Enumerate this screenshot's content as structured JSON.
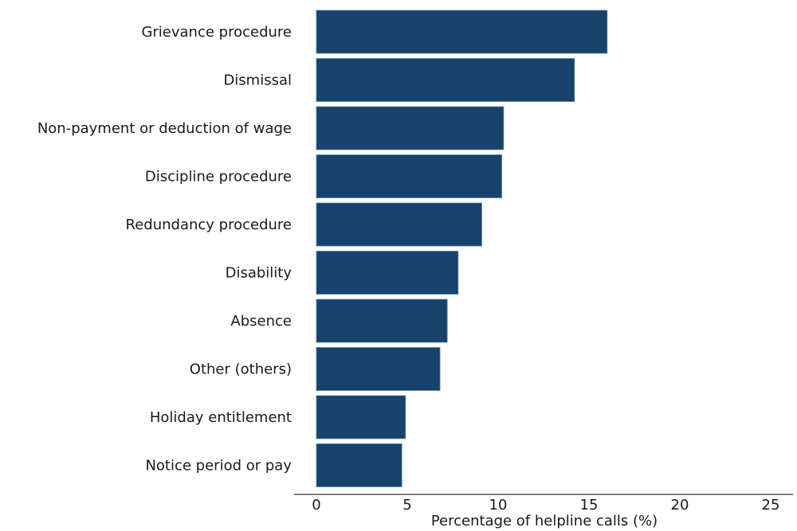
{
  "chart_data": {
    "type": "bar",
    "orientation": "horizontal",
    "title": "",
    "xlabel": "Percentage of helpline calls (%)",
    "ylabel": "",
    "xlim": [
      0,
      25
    ],
    "xticks": [
      0,
      5,
      10,
      15,
      20,
      25
    ],
    "xtick_labels": [
      "0",
      "5",
      "10",
      "15",
      "20",
      "25"
    ],
    "grid": false,
    "legend": "none",
    "bar_color": "#16426b",
    "categories": [
      "Grievance procedure",
      "Dismissal",
      "Non-payment or deduction of wage",
      "Discipline procedure",
      "Redundancy procedure",
      "Disability",
      "Absence",
      "Other (others)",
      "Holiday entitlement",
      "Notice period or pay"
    ],
    "values": [
      16.0,
      14.2,
      10.3,
      10.2,
      9.1,
      7.8,
      7.2,
      6.8,
      4.9,
      4.7
    ]
  }
}
